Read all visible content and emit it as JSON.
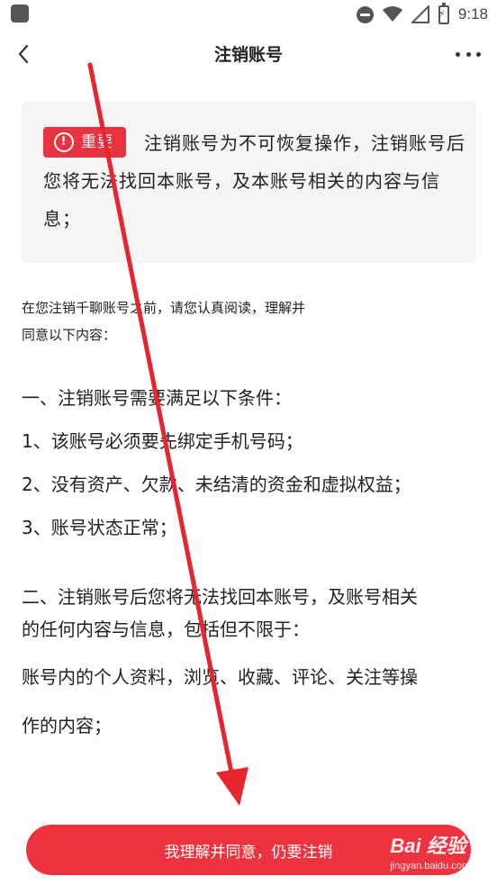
{
  "status_bar": {
    "time": "9:18",
    "icons": [
      "app-icon",
      "do-not-disturb-icon",
      "wifi-icon",
      "signal-icon",
      "battery-charging-icon"
    ]
  },
  "nav": {
    "title": "注销账号",
    "back_icon": "chevron-left-icon",
    "more_icon": "more-dots-icon"
  },
  "notice": {
    "badge_label": "重要",
    "badge_icon": "!",
    "text": "注销账号为不可恢复操作，注销账号后您将无法找回本账号，及本账号相关的内容与信息；",
    "badge_color": "#e93340"
  },
  "intro": {
    "line1": "在您注销千聊账号之前，请您认真阅读，理解并",
    "line2": "同意以下内容："
  },
  "section1": {
    "heading": "一、注销账号需要满足以下条件：",
    "items": [
      "1、该账号必须要先绑定手机号码；",
      "2、没有资产、欠款、未结清的资金和虚拟权益；",
      "3、账号状态正常；"
    ]
  },
  "section2": {
    "heading_line1": "二、注销账号后您将无法找回本账号，及账号相关",
    "heading_line2": "的任何内容与信息，包括但不限于：",
    "detail_line1": "账号内的个人资料，浏览、收藏、评论、关注等操",
    "detail_line2": "作的内容；"
  },
  "footer": {
    "cancel_button_label": "我理解并同意，仍要注销",
    "button_color": "#ee3340"
  },
  "watermark": {
    "logo": "Bai 经验",
    "url": "jingyan.baidu.com"
  },
  "annotation": {
    "arrow_color": "#e8242f"
  }
}
